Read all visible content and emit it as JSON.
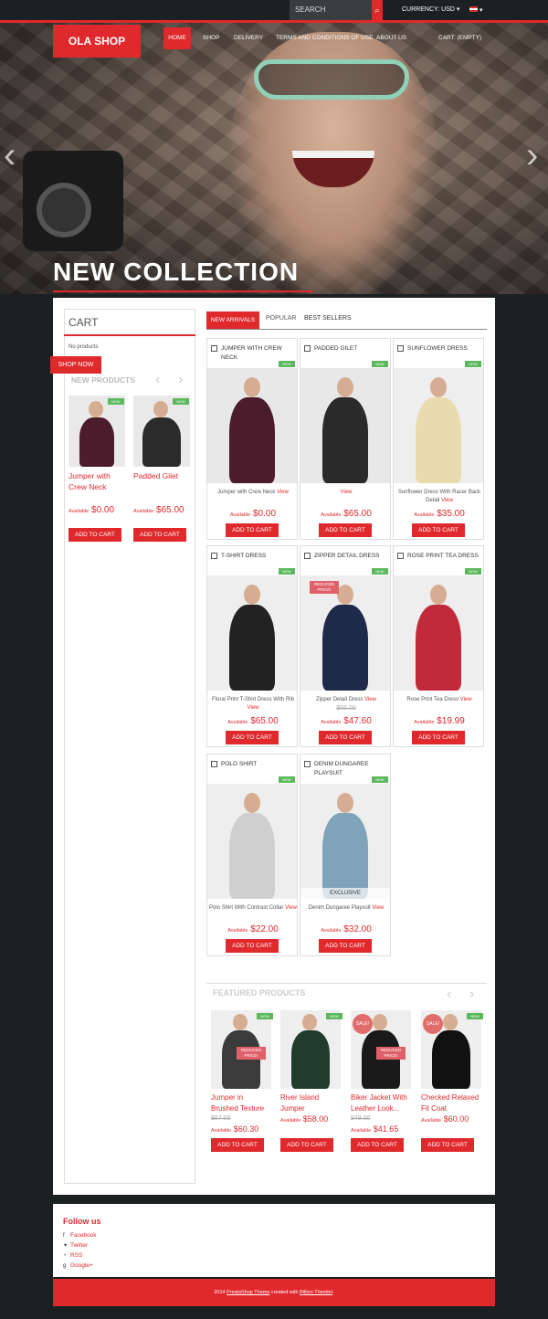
{
  "topbar": {
    "search_placeholder": "SEARCH",
    "currency": "CURRENCY: USD",
    "search_icon": "search-icon"
  },
  "header": {
    "logo": "OLA SHOP",
    "nav": [
      "HOME",
      "SHOP",
      "DELIVERY",
      "TERMS AND CONDITIONS OF USE",
      "ABOUT US"
    ],
    "cart": "CART: (EMPTY)"
  },
  "hero": {
    "title": "NEW COLLECTION",
    "prev": "‹",
    "next": "›"
  },
  "sidebar": {
    "cart_title": "CART",
    "no_products": "No products",
    "shop_now": "SHOP NOW",
    "new_products_title": "NEW PRODUCTS",
    "products": [
      {
        "name_line1": "Jumper with",
        "name_line2": "Crew Neck",
        "available": "Available",
        "price": "$0.00",
        "add": "ADD TO CART",
        "badge": "NEW"
      },
      {
        "name_line1": "Padded Gilet",
        "name_line2": "",
        "available": "Available",
        "price": "$65.00",
        "add": "ADD TO CART",
        "badge": "NEW"
      }
    ]
  },
  "tabs": [
    "NEW ARRIVALS",
    "POPULAR",
    "BEST SELLERS"
  ],
  "grid": [
    {
      "name1": "JUMPER WITH CREW",
      "name2": "NECK",
      "desc1": "Jumper with Crew Neck",
      "desc2": "",
      "view": "View",
      "available": "Available",
      "price": "$0.00",
      "old": "",
      "add": "ADD TO CART",
      "badge": "NEW"
    },
    {
      "name1": "PADDED GILET",
      "name2": "",
      "desc1": "",
      "desc2": "",
      "view": "View",
      "available": "Available",
      "price": "$65.00",
      "old": "",
      "add": "ADD TO CART",
      "badge": "NEW"
    },
    {
      "name1": "SUNFLOWER DRESS",
      "name2": "",
      "desc1": "Sunflower Dress With Racer Back",
      "desc2": "Detail",
      "view": "View",
      "available": "Available",
      "price": "$35.00",
      "old": "",
      "add": "ADD TO CART",
      "badge": "NEW"
    },
    {
      "name1": "T-SHIRT DRESS",
      "name2": "",
      "desc1": "Floral Print T-Shirt Dress With Rib",
      "desc2": "",
      "view": "View",
      "available": "Available",
      "price": "$65.00",
      "old": "",
      "add": "ADD TO CART",
      "badge": "NEW"
    },
    {
      "name1": "ZIPPER DETAIL DRESS",
      "name2": "",
      "desc1": "Zipper Detail Dress",
      "desc2": "",
      "view": "View",
      "available": "Available",
      "price": "$47.60",
      "old": "$56.00",
      "add": "ADD TO CART",
      "badge": "NEW",
      "reduced": "REDUCED PRICE!"
    },
    {
      "name1": "ROSE PRINT TEA DRESS",
      "name2": "",
      "desc1": "Rose Print Tea Dress",
      "desc2": "",
      "view": "View",
      "available": "Available",
      "price": "$19.99",
      "old": "",
      "add": "ADD TO CART",
      "badge": "NEW"
    },
    {
      "name1": "POLO SHIRT",
      "name2": "",
      "desc1": "Polo Shirt With Contrast Collar",
      "desc2": "",
      "view": "View",
      "available": "Available",
      "price": "$22.00",
      "old": "",
      "add": "ADD TO CART",
      "badge": "NEW"
    },
    {
      "name1": "DENIM DUNGAREE",
      "name2": "PLAYSUIT",
      "desc1": "Denim Dungaree Playsuit",
      "desc2": "",
      "view": "View",
      "available": "Available",
      "price": "$32.00",
      "old": "",
      "add": "ADD TO CART",
      "badge": "NEW",
      "exclusive": "EXCLUSIVE"
    }
  ],
  "featured": {
    "title": "FEATURED PRODUCTS",
    "items": [
      {
        "name1": "Jumper in",
        "name2": "Brushed Texture",
        "old": "$67.00",
        "available": "Available",
        "price": "$60.30",
        "add": "ADD TO CART",
        "badge": "NEW",
        "reduced": "REDUCED PRICE!"
      },
      {
        "name1": "River Island",
        "name2": "Jumper",
        "old": "",
        "available": "Available",
        "price": "$58.00",
        "add": "ADD TO CART",
        "badge": "NEW"
      },
      {
        "name1": "Biker Jacket With",
        "name2": "Leather Look...",
        "old": "$49.00",
        "available": "Available",
        "price": "$41.65",
        "add": "ADD TO CART",
        "badge": "",
        "sale": "SALE!",
        "reduced": "REDUCED PRICE!"
      },
      {
        "name1": "Checked Relaxed",
        "name2": "Fit Coat",
        "old": "",
        "available": "Available",
        "price": "$60.00",
        "add": "ADD TO CART",
        "badge": "NEW",
        "sale": "SALE!"
      }
    ]
  },
  "footer": {
    "follow": "Follow us",
    "links": [
      "Facebook",
      "Twitter",
      "RSS",
      "Google+"
    ],
    "copy_pre": "2014 ",
    "copy_link1": "PrestaShop Theme",
    "copy_mid": " created with ",
    "copy_link2": "Billion Themler",
    "copy_post": "."
  }
}
